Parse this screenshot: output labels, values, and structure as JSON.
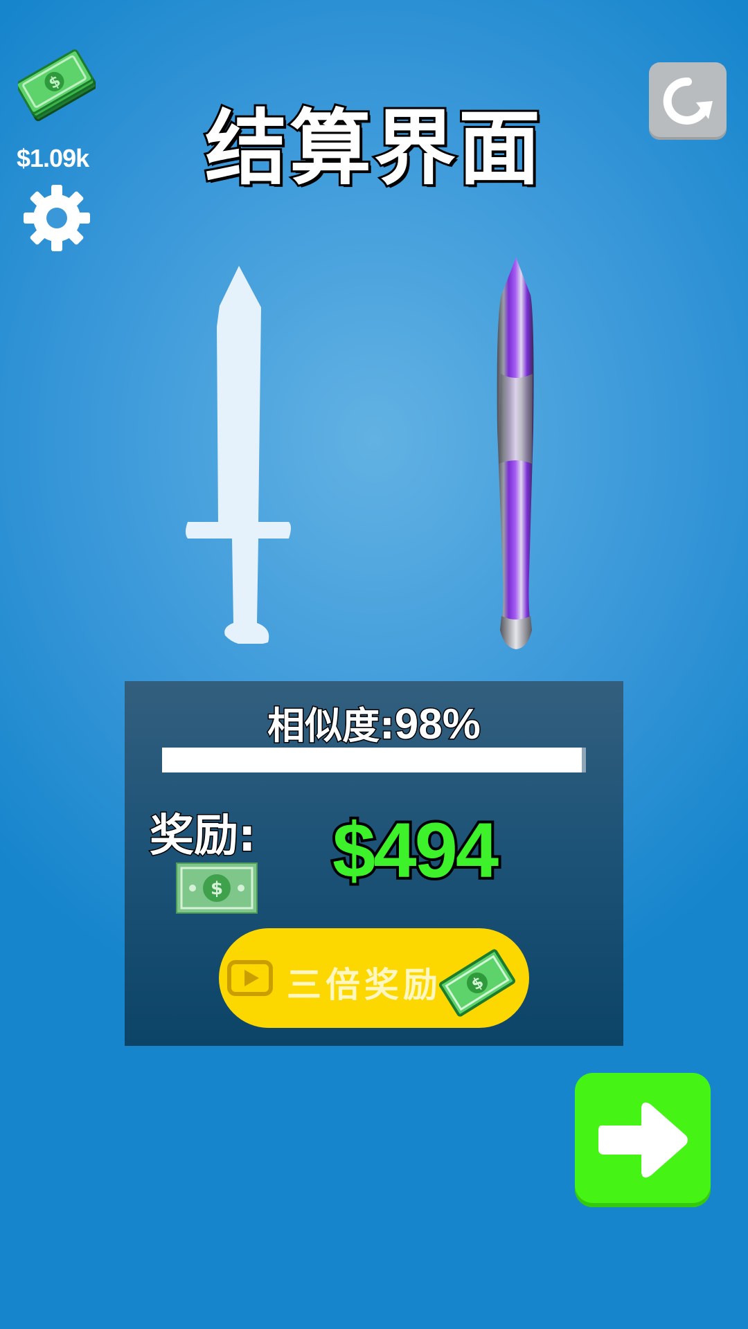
{
  "hud": {
    "money": "$1.09k"
  },
  "title": "结算界面",
  "result": {
    "similarity_label": "相似度:",
    "similarity_value": "98%",
    "similarity_progress": 0.99,
    "reward_label": "奖励:",
    "reward_amount": "$494",
    "triple_button_label": "三倍奖励"
  },
  "icons": {
    "money": "cash-stack-icon",
    "settings": "gear-icon",
    "restart": "restart-icon",
    "reward": "banknote-icon",
    "video": "video-play-icon",
    "next": "arrow-right-icon"
  },
  "colors": {
    "background": "#1685cc",
    "reward_amount": "#3df22a",
    "triple_button": "#fdd700",
    "next_button": "#45f414",
    "restart_button": "#b9bcbe",
    "sword_blade": "#8a3fe0"
  }
}
